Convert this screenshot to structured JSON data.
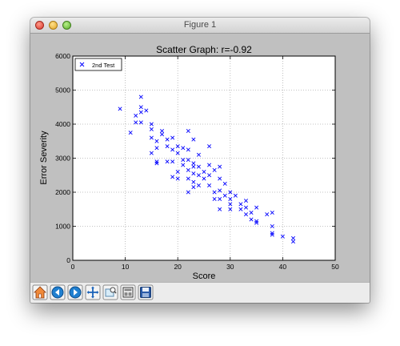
{
  "window": {
    "title": "Figure 1"
  },
  "toolbar": {
    "buttons": [
      {
        "name": "home-icon"
      },
      {
        "name": "back-icon"
      },
      {
        "name": "forward-icon"
      },
      {
        "name": "pan-icon"
      },
      {
        "name": "zoom-rect-icon"
      },
      {
        "name": "subplots-icon"
      },
      {
        "name": "save-icon"
      }
    ]
  },
  "chart_data": {
    "type": "scatter",
    "title": "Scatter Graph: r=-0.92",
    "xlabel": "Score",
    "ylabel": "Error Severity",
    "xlim": [
      0,
      50
    ],
    "ylim": [
      0,
      6000
    ],
    "xticks": [
      "0",
      "10",
      "20",
      "30",
      "40",
      "50"
    ],
    "yticks": [
      "0",
      "1000",
      "2000",
      "3000",
      "4000",
      "5000",
      "6000"
    ],
    "grid": true,
    "legend_position": "top-left",
    "marker": "x",
    "color": "#0000ff",
    "series": [
      {
        "name": "2nd Test",
        "points": [
          [
            9,
            4450
          ],
          [
            11,
            3750
          ],
          [
            12,
            4050
          ],
          [
            12,
            4250
          ],
          [
            13,
            4800
          ],
          [
            13,
            4500
          ],
          [
            13,
            4350
          ],
          [
            13,
            4050
          ],
          [
            14,
            4400
          ],
          [
            15,
            4000
          ],
          [
            15,
            3850
          ],
          [
            15,
            3600
          ],
          [
            15,
            3150
          ],
          [
            16,
            3300
          ],
          [
            16,
            3500
          ],
          [
            16,
            2900
          ],
          [
            16,
            2850
          ],
          [
            17,
            3800
          ],
          [
            17,
            3700
          ],
          [
            18,
            3550
          ],
          [
            18,
            3350
          ],
          [
            18,
            2900
          ],
          [
            19,
            3600
          ],
          [
            19,
            3250
          ],
          [
            19,
            2900
          ],
          [
            19,
            2450
          ],
          [
            20,
            3150
          ],
          [
            20,
            3350
          ],
          [
            20,
            2600
          ],
          [
            20,
            2400
          ],
          [
            21,
            2950
          ],
          [
            21,
            3300
          ],
          [
            21,
            2800
          ],
          [
            22,
            3800
          ],
          [
            22,
            3250
          ],
          [
            22,
            2950
          ],
          [
            22,
            2650
          ],
          [
            22,
            2400
          ],
          [
            22,
            2000
          ],
          [
            23,
            3550
          ],
          [
            23,
            2850
          ],
          [
            23,
            2750
          ],
          [
            23,
            2550
          ],
          [
            23,
            2300
          ],
          [
            23,
            2150
          ],
          [
            24,
            3100
          ],
          [
            24,
            2750
          ],
          [
            24,
            2500
          ],
          [
            24,
            2200
          ],
          [
            25,
            2600
          ],
          [
            25,
            2400
          ],
          [
            26,
            3350
          ],
          [
            26,
            2800
          ],
          [
            26,
            2500
          ],
          [
            26,
            2200
          ],
          [
            27,
            2650
          ],
          [
            27,
            2000
          ],
          [
            27,
            1800
          ],
          [
            28,
            2750
          ],
          [
            28,
            2400
          ],
          [
            28,
            2050
          ],
          [
            28,
            1800
          ],
          [
            28,
            1500
          ],
          [
            29,
            2250
          ],
          [
            29,
            1900
          ],
          [
            30,
            2000
          ],
          [
            30,
            1800
          ],
          [
            30,
            1650
          ],
          [
            30,
            1500
          ],
          [
            31,
            1900
          ],
          [
            32,
            1650
          ],
          [
            32,
            1500
          ],
          [
            33,
            1750
          ],
          [
            33,
            1550
          ],
          [
            33,
            1350
          ],
          [
            34,
            1400
          ],
          [
            34,
            1200
          ],
          [
            35,
            1550
          ],
          [
            35,
            1150
          ],
          [
            35,
            1100
          ],
          [
            37,
            1350
          ],
          [
            38,
            1400
          ],
          [
            38,
            1000
          ],
          [
            38,
            800
          ],
          [
            38,
            750
          ],
          [
            40,
            700
          ],
          [
            42,
            650
          ],
          [
            42,
            550
          ]
        ]
      }
    ]
  }
}
